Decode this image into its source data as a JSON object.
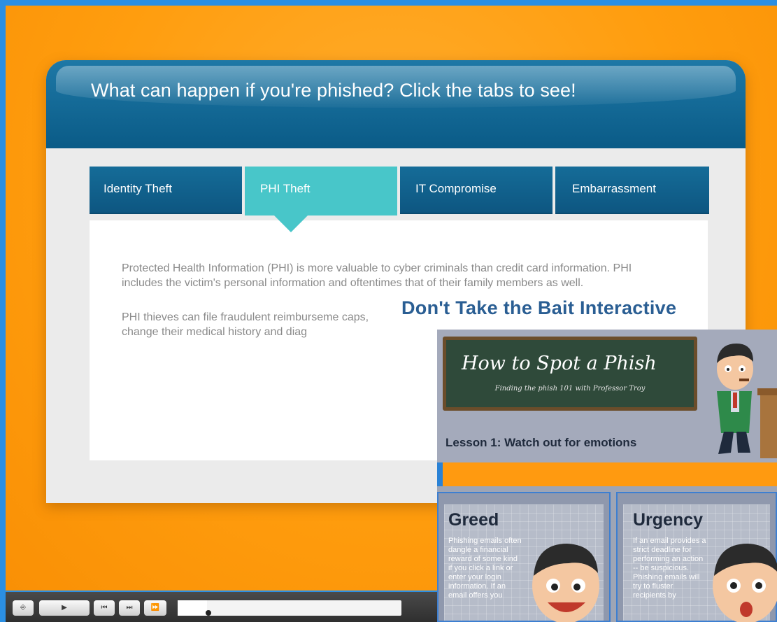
{
  "slide": {
    "title": "What can happen if you're phished? Click the tabs to see!",
    "tabs": [
      {
        "label": "Identity Theft",
        "active": false
      },
      {
        "label": "PHI Theft",
        "active": true
      },
      {
        "label": "IT Compromise",
        "active": false
      },
      {
        "label": "Embarrassment",
        "active": false
      }
    ],
    "paragraphs": [
      "Protected Health Information (PHI) is more valuable to cyber criminals than credit card information. PHI includes the victim's personal information and oftentimes that of their family members as well.",
      "PHI thieves can file fraudulent reimburseme caps, change their medical history and diag"
    ]
  },
  "player": {
    "buttons": [
      {
        "name": "exit",
        "glyph": "⎆"
      },
      {
        "name": "play",
        "glyph": "▶"
      },
      {
        "name": "previous",
        "glyph": "⏮"
      },
      {
        "name": "next",
        "glyph": "⏭"
      },
      {
        "name": "fast-forward",
        "glyph": "⏩"
      }
    ],
    "progress": 0.13
  },
  "overlay": {
    "title": "Don't Take the Bait Interactive",
    "board_title": "How to Spot a Phish",
    "board_subtitle": "Finding the phish 101 with Professor Troy",
    "lesson": "Lesson 1: Watch out for emotions",
    "cards": [
      {
        "heading": "Greed",
        "text": "Phishing emails often dangle a financial reward of some kind if you click a link or enter your login information. If an email offers you"
      },
      {
        "heading": "Urgency",
        "text": "If an email provides a strict deadline for performing an action -- be suspicious. Phishing emails will try to fluster recipients by"
      }
    ]
  },
  "colors": {
    "stage_orange": "#ff9d0e",
    "header_blue": "#0a5b87",
    "active_tab_teal": "#48c6c9",
    "overlay_title_blue": "#2a5e93",
    "promo_gray": "#9ea5b5",
    "accent_blue": "#2b8fe3"
  }
}
